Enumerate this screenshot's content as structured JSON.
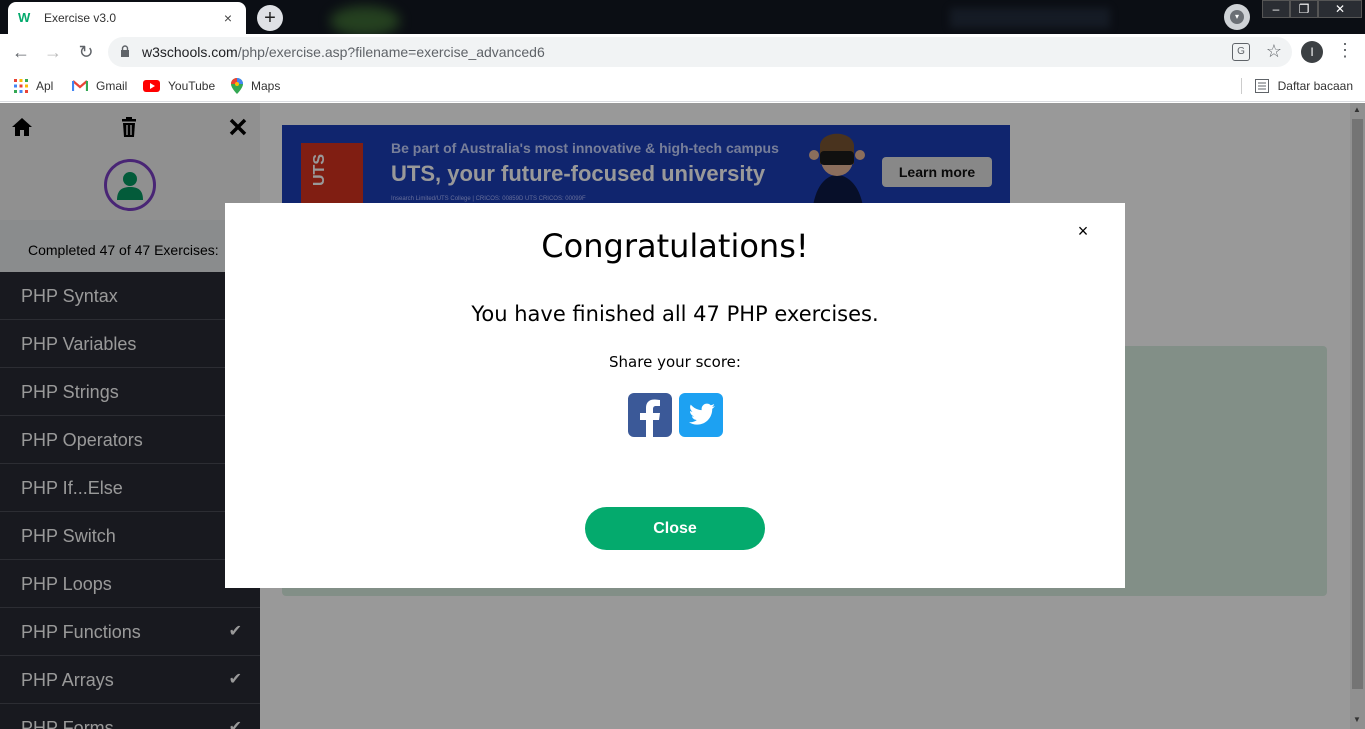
{
  "browser": {
    "tab_title": "Exercise v3.0",
    "tab_close": "×",
    "new_tab": "+",
    "url_host": "w3schools.com",
    "url_path": "/php/exercise.asp?filename=exercise_advanced6",
    "profile_initial": "I",
    "window_controls": [
      "–",
      "❐",
      "✕"
    ]
  },
  "bookmarks": {
    "items": [
      {
        "label": "Apl",
        "icon": "apps-grid-icon"
      },
      {
        "label": "Gmail",
        "icon": "gmail-icon"
      },
      {
        "label": "YouTube",
        "icon": "youtube-icon"
      },
      {
        "label": "Maps",
        "icon": "maps-icon"
      }
    ],
    "reading_list": "Daftar bacaan"
  },
  "sidebar": {
    "progress_text": "Completed 47 of 47 Exercises:",
    "items": [
      {
        "label": "PHP Syntax",
        "checked": false
      },
      {
        "label": "PHP Variables",
        "checked": false
      },
      {
        "label": "PHP Strings",
        "checked": false
      },
      {
        "label": "PHP Operators",
        "checked": false
      },
      {
        "label": "PHP If...Else",
        "checked": false
      },
      {
        "label": "PHP Switch",
        "checked": false
      },
      {
        "label": "PHP Loops",
        "checked": false
      },
      {
        "label": "PHP Functions",
        "checked": true
      },
      {
        "label": "PHP Arrays",
        "checked": true
      },
      {
        "label": "PHP Forms",
        "checked": true
      }
    ],
    "check_glyph": "✔"
  },
  "ad": {
    "logo_text": "UTS",
    "line1": "Be part of Australia's most innovative & high-tech campus",
    "line2": "UTS, your future-focused university",
    "line3": "Insearch Limited/UTS College | CRICOS: 00859D  UTS CRICOS: 00099F",
    "button": "Learn more"
  },
  "modal": {
    "title": "Congratulations!",
    "message": "You have finished all 47 PHP exercises.",
    "share_label": "Share your score:",
    "close_x": "×",
    "close_button": "Close"
  },
  "colors": {
    "accent_green": "#04aa6d",
    "sidebar_bg": "#282a35",
    "facebook": "#3b5998",
    "twitter": "#1da1f2",
    "ad_blue": "#1c3eb8"
  }
}
